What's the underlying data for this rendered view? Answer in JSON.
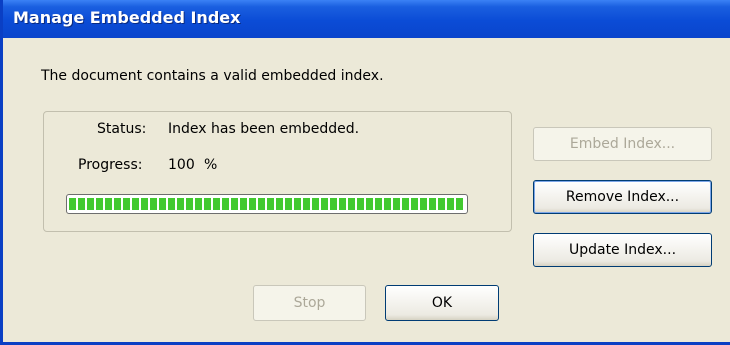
{
  "window": {
    "title": "Manage Embedded Index"
  },
  "message": "The document contains a valid embedded index.",
  "status": {
    "label": "Status:",
    "value": "Index has been embedded."
  },
  "progress": {
    "label": "Progress:",
    "value": "100",
    "unit": "%",
    "fraction": 1.0,
    "fill_color": "#42c92f"
  },
  "buttons": {
    "embed": {
      "label": "Embed Index...",
      "enabled": false
    },
    "remove": {
      "label": "Remove Index...",
      "enabled": true
    },
    "update": {
      "label": "Update Index...",
      "enabled": true
    },
    "stop": {
      "label": "Stop",
      "enabled": false
    },
    "ok": {
      "label": "OK",
      "enabled": true
    }
  },
  "colors": {
    "titlebar": "#0a45cc",
    "dialog_bg": "#ece9d8"
  }
}
